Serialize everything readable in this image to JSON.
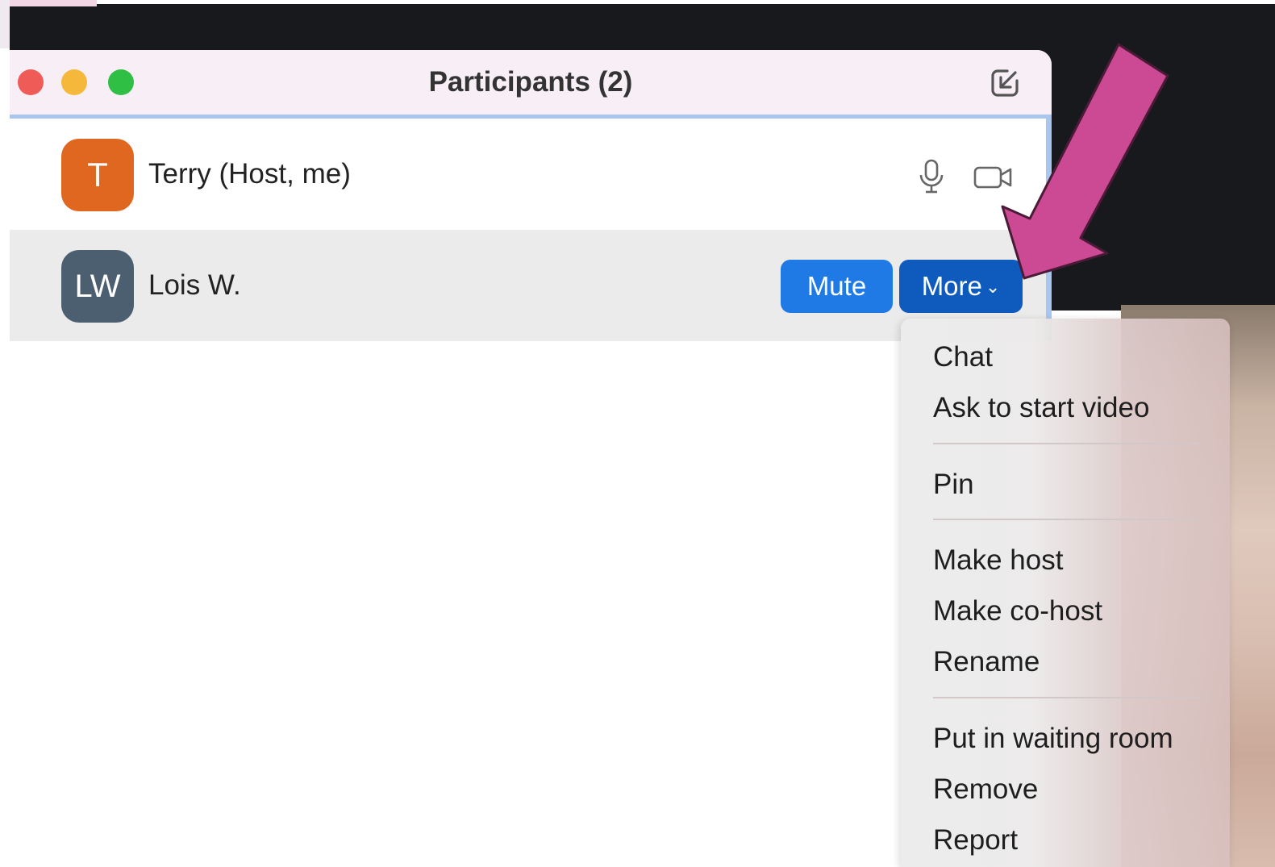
{
  "window": {
    "title": "Participants (2)"
  },
  "participants": [
    {
      "initials": "T",
      "name": "Terry (Host, me)",
      "avatar_color": "#e0671f"
    },
    {
      "initials": "LW",
      "name": "Lois W.",
      "avatar_color": "#4c5f70"
    }
  ],
  "actions": {
    "mute_label": "Mute",
    "more_label": "More"
  },
  "menu": {
    "items": [
      "Chat",
      "Ask to start video",
      "Pin",
      "Make host",
      "Make co-host",
      "Rename",
      "Put in waiting room",
      "Remove",
      "Report"
    ]
  },
  "colors": {
    "accent_blue": "#1f7ae5",
    "more_blue": "#0e5bbd",
    "annotation_arrow": "#cc4a94"
  },
  "icons": [
    "pop-in-icon",
    "microphone-icon",
    "video-camera-icon",
    "chevron-down-icon",
    "annotation-arrow"
  ]
}
